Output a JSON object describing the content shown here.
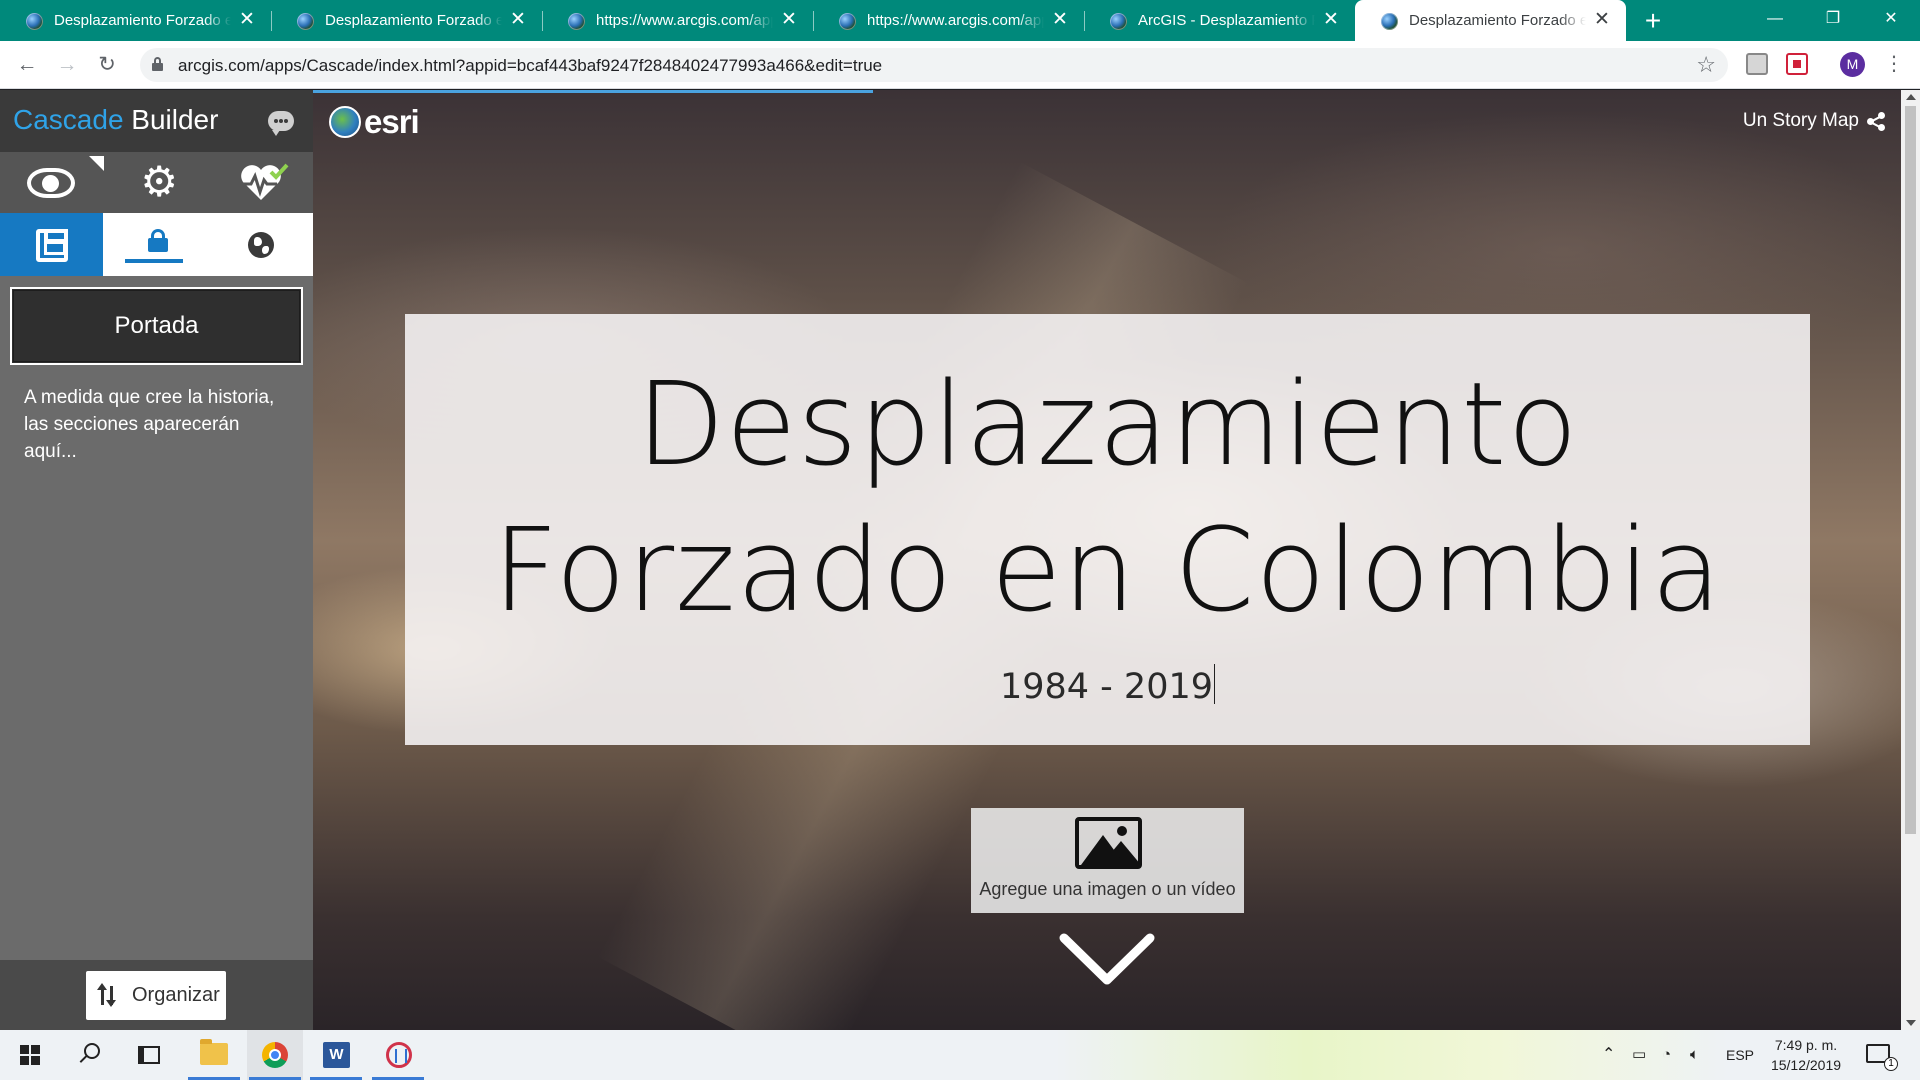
{
  "browser": {
    "tabs": [
      {
        "title": "Desplazamiento Forzado en Colombia",
        "active": false
      },
      {
        "title": "Desplazamiento Forzado en Colombia",
        "active": false
      },
      {
        "title": "https://www.arcgis.com/apps/",
        "active": false
      },
      {
        "title": "https://www.arcgis.com/apps/",
        "active": false
      },
      {
        "title": "ArcGIS - Desplazamiento Forzado",
        "active": false
      },
      {
        "title": "Desplazamiento Forzado en Colombia",
        "active": true
      }
    ],
    "new_tab_glyph": "+",
    "window_controls": {
      "minimize": "—",
      "restore": "❐",
      "close": "✕"
    },
    "url": "arcgis.com/apps/Cascade/index.html?appid=bcaf443baf9247f2848402477993a466&edit=true",
    "profile_initial": "M"
  },
  "builder": {
    "brand_first": "Cascade",
    "brand_second": "Builder",
    "first_section": "Portada",
    "hint": "A medida que cree la historia, las secciones aparecerán aquí...",
    "organize_label": "Organizar",
    "accent_color": "#1679c2"
  },
  "story": {
    "logo_text": "esri",
    "top_link": "Un Story Map",
    "title": "Desplazamiento Forzado en Colombia",
    "subtitle": "1984 - 2019",
    "media_prompt": "Agregue una imagen o un vídeo"
  },
  "taskbar": {
    "language": "ESP",
    "time": "7:49 p. m.",
    "date": "15/12/2019",
    "notification_count": "1"
  }
}
